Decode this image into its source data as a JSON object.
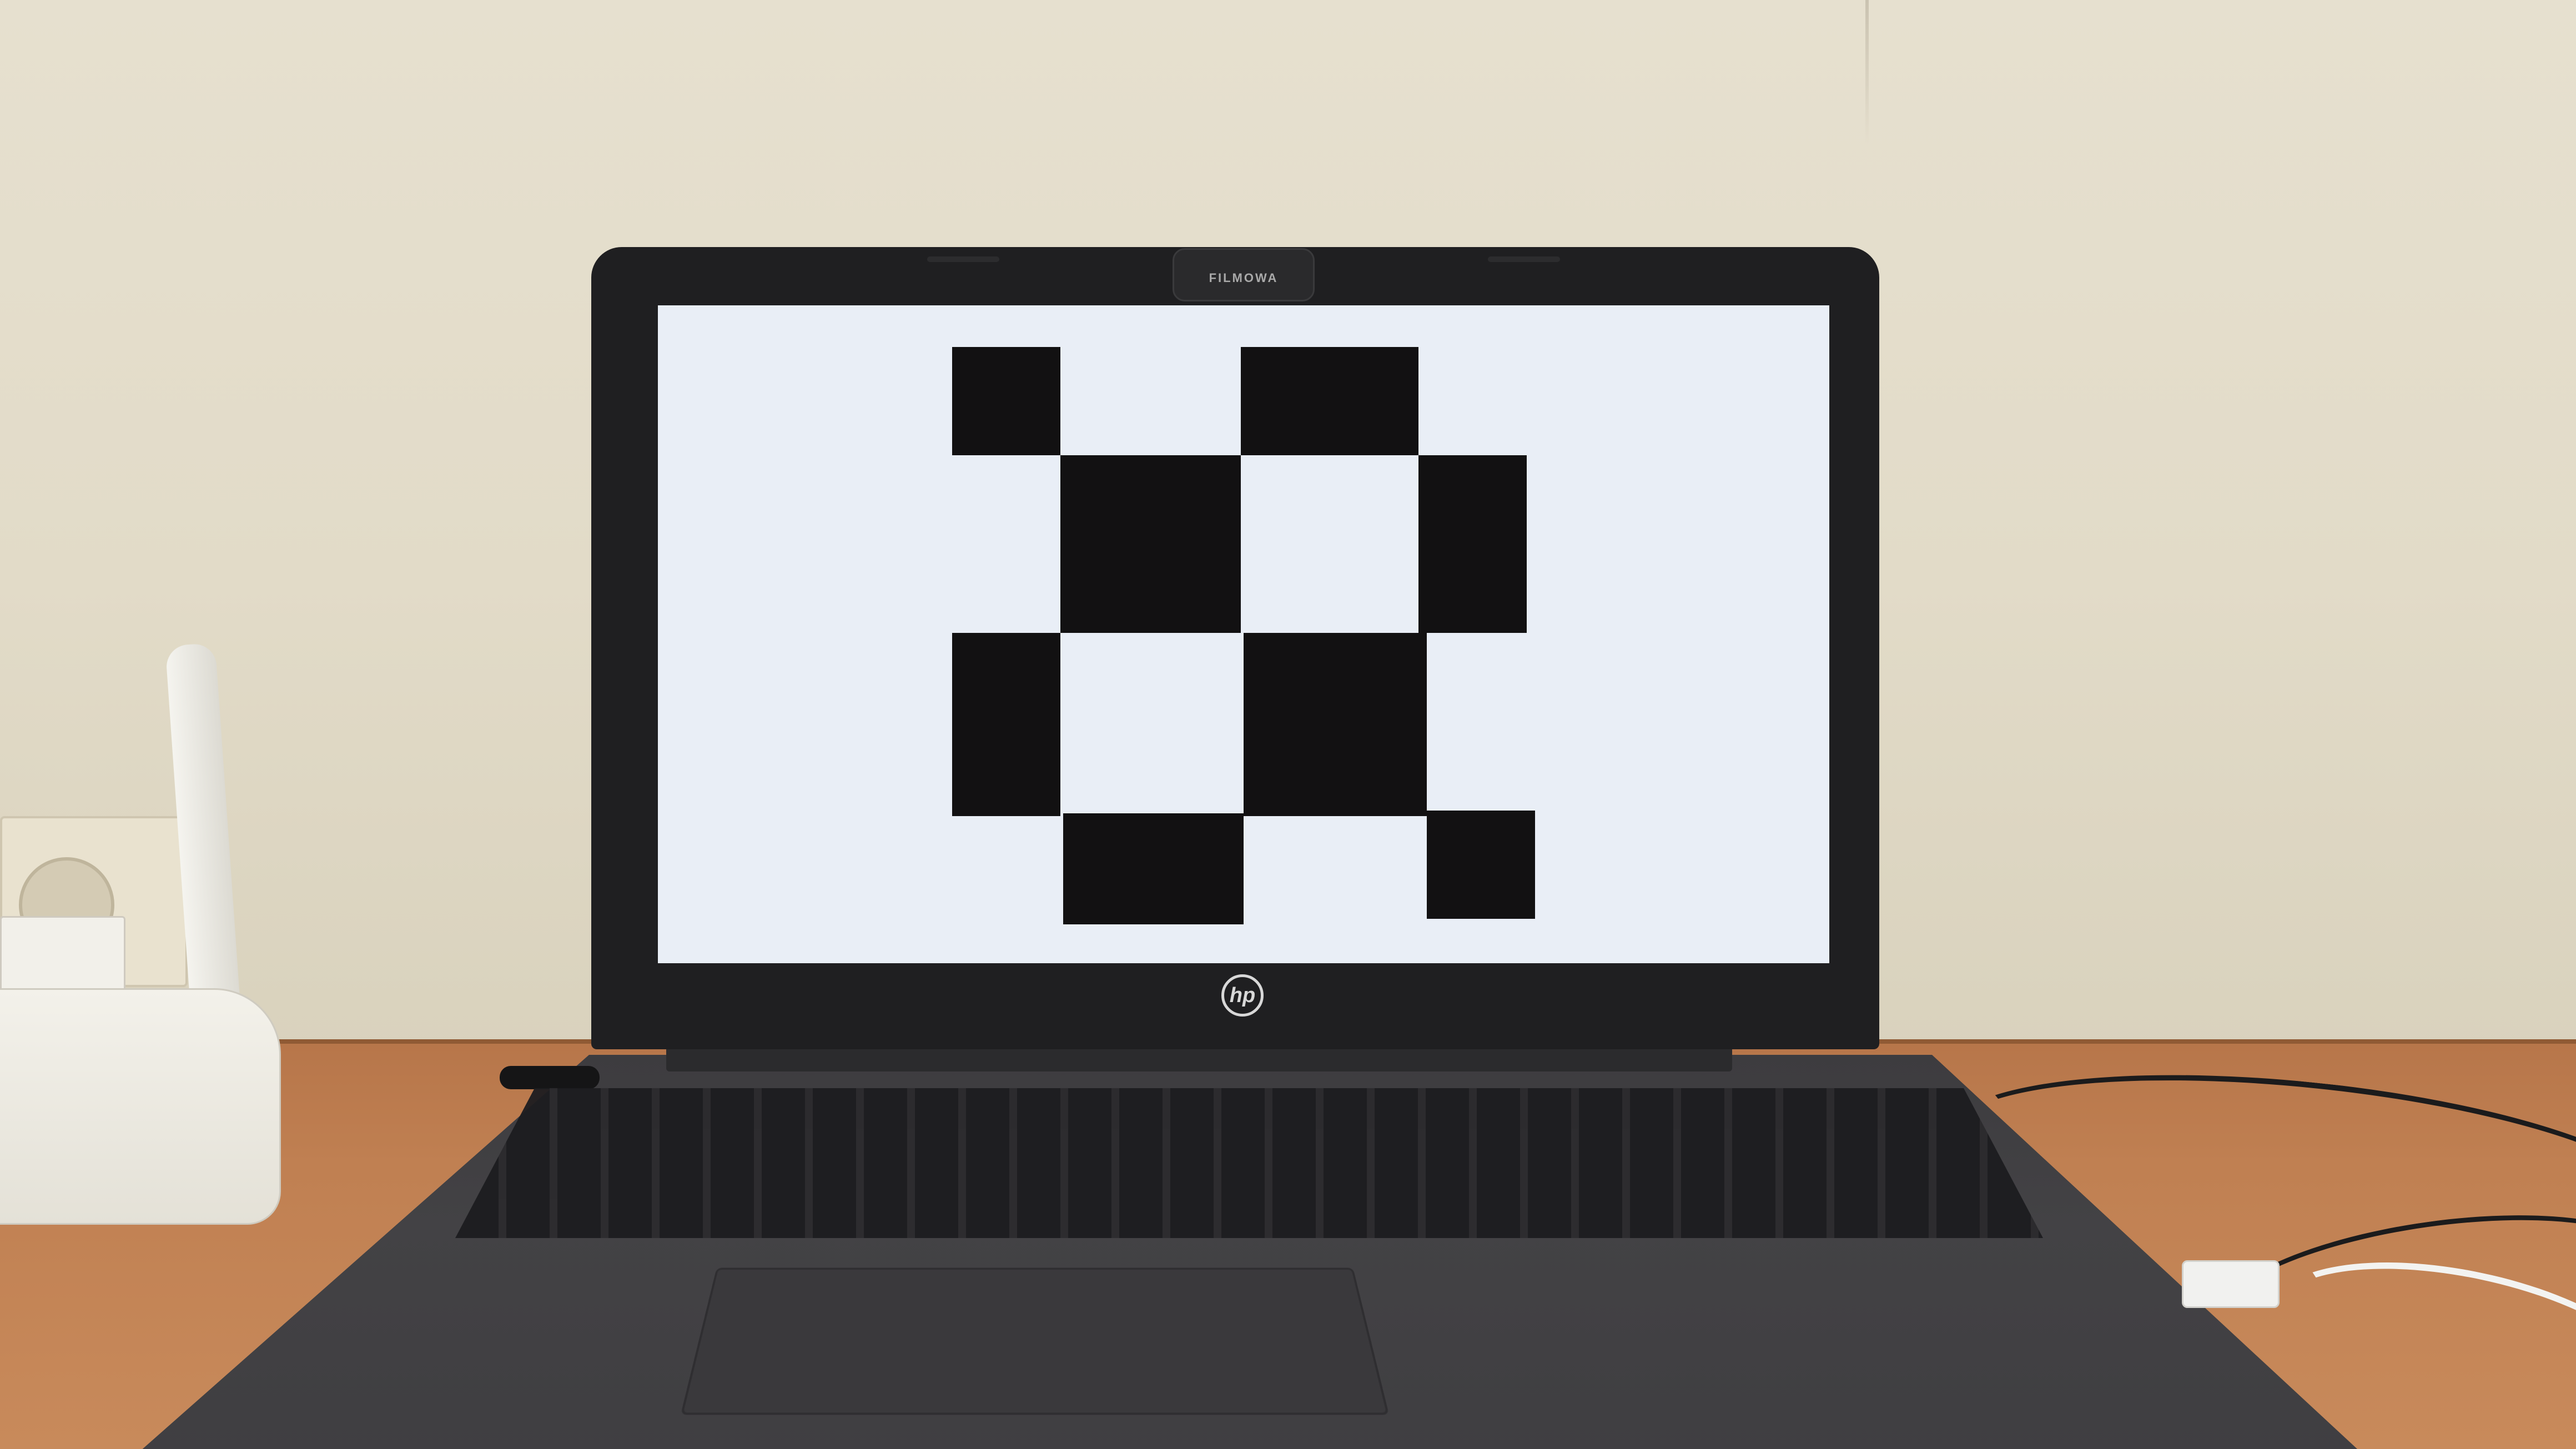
{
  "laptop": {
    "brand_logo": "hp",
    "webcam_cover_text": "FILMOWA"
  },
  "screen": {
    "background_color": "#e9eef6",
    "square_color": "#121112",
    "pattern": "checkerboard"
  },
  "colors": {
    "wall": "#e2dbc8",
    "desk": "#c08052",
    "laptop_body": "#1f1f21"
  }
}
